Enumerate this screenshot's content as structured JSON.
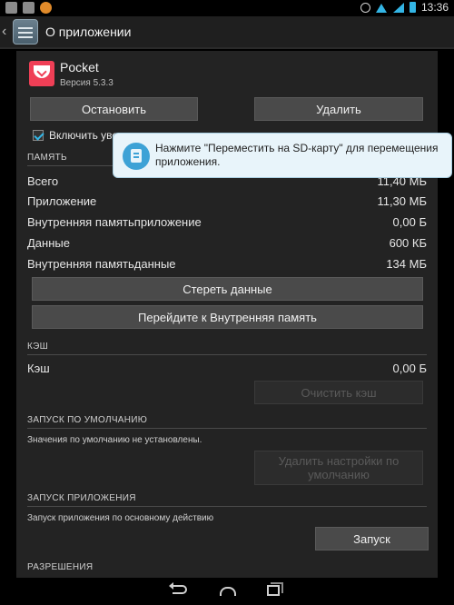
{
  "status_bar": {
    "time": "13:36",
    "icons": [
      "notification-icon",
      "image-icon",
      "app-notification-icon",
      "alarm-clock-icon",
      "wifi-icon",
      "signal-icon",
      "battery-icon"
    ]
  },
  "action_bar": {
    "title": "О приложении",
    "icon": "app-settings-icon"
  },
  "app": {
    "name": "Pocket",
    "version": "Версия 5.3.3",
    "icon": "pocket-icon",
    "brand_color": "#ef3f56"
  },
  "buttons": {
    "stop": "Остановить",
    "uninstall": "Удалить",
    "clear_data": "Стереть данные",
    "move_to_internal": "Перейдите к Внутренняя память",
    "clear_cache": "Очистить кэш",
    "clear_defaults": "Удалить настройки по умолчанию",
    "launch": "Запуск"
  },
  "notifications_checkbox": {
    "label": "Включить уве",
    "checked": true
  },
  "tooltip": {
    "text": "Нажмите \"Переместить на SD-карту\" для перемещения приложения.",
    "icon": "sd-card-icon"
  },
  "storage": {
    "header": "ПАМЯТЬ",
    "rows": [
      {
        "label": "Всего",
        "value": "11,40 МБ"
      },
      {
        "label": "Приложение",
        "value": "11,30 МБ"
      },
      {
        "label": "Внутренняя памятьприложение",
        "value": "0,00 Б"
      },
      {
        "label": "Данные",
        "value": "600 КБ"
      },
      {
        "label": "Внутренняя памятьданные",
        "value": "134 МБ"
      }
    ]
  },
  "cache": {
    "header": "КЭШ",
    "label": "Кэш",
    "value": "0,00 Б"
  },
  "defaults": {
    "header": "ЗАПУСК ПО УМОЛЧАНИЮ",
    "text": "Значения по умолчанию не установлены."
  },
  "launch_section": {
    "header": "ЗАПУСК ПРИЛОЖЕНИЯ",
    "text": "Запуск приложения по основному действию"
  },
  "permissions": {
    "header": "РАЗРЕШЕНИЯ"
  },
  "colors": {
    "accent": "#33b5e5",
    "tooltip_bg": "#e8f4fa"
  },
  "nav_bar": {
    "icons": [
      "back-icon",
      "home-icon",
      "recent-apps-icon"
    ]
  }
}
